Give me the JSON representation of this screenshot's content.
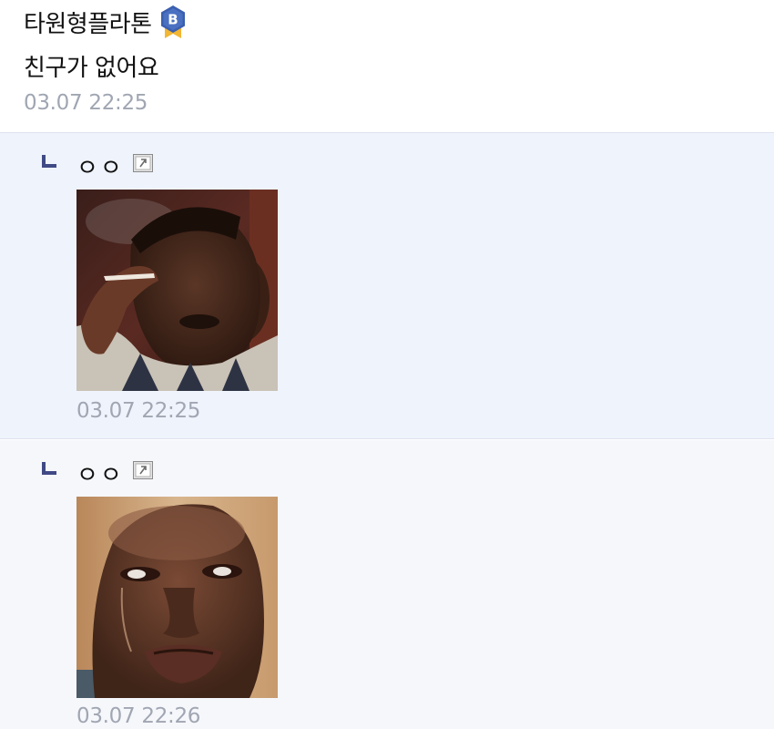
{
  "post": {
    "author": "타원형플라톤",
    "badge_letter": "B",
    "text": "친구가 없어요",
    "time": "03.07 22:25"
  },
  "replies": [
    {
      "author": "ㅇㅇ",
      "time": "03.07 22:25",
      "image": "crying-smoking-man-meme"
    },
    {
      "author": "ㅇㅇ",
      "time": "03.07 22:26",
      "image": "crying-man-closeup-meme"
    }
  ],
  "colors": {
    "badge": "#3b5fae",
    "badge_ribbon": "#f2b632",
    "reply_arrow": "#3f4a85",
    "timestamp": "#a0a6b2",
    "reply_bg_1": "#eff3fb",
    "reply_bg_2": "#f6f7fb"
  }
}
